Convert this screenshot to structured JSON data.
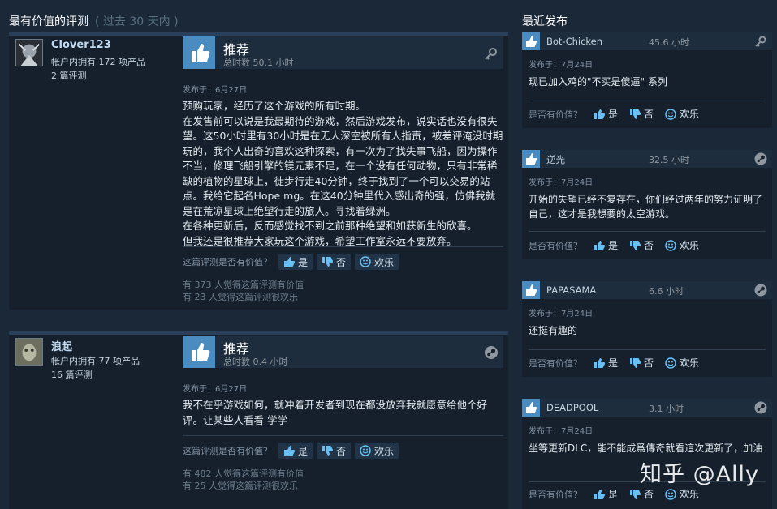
{
  "left_header": {
    "title": "最有价值的评测",
    "subtitle": "( 过去 30 天内 )"
  },
  "right_header": {
    "title": "最近发布"
  },
  "reviews": [
    {
      "username": "Clover123",
      "products": "帐户内拥有 172 项产品",
      "review_count": "2 篇评测",
      "recommend": "推荐",
      "hours": "总时数 50.1 小时",
      "posted": "发布于：6月27日",
      "text": "预购玩家，经历了这个游戏的所有时期。\n在发售前可以说是我最期待的游戏，然后游戏发布，说实话也没有很失望。这50小时里有30小时是在无人深空被所有人指责，被差评淹没时期玩的，我个人出奇的喜欢这种探索，有一次为了找失事飞船，因为操作不当，修理飞船引擎的镁元素不足，在一个没有任何动物，只有非常稀缺的植物的星球上，徒步行走40分钟，终于找到了一个可以交易的站点。我给它起名Hope mg。在这40分钟里代入感出奇的强，仿佛我就是在荒凉星球上绝望行走的旅人。寻找着绿洲。\n在各种更新后，反而感觉找不到之前那种绝望和如获新生的欣喜。\n但我还是很推荐大家玩这个游戏，希望工作室永远不要放弃。",
      "helpful_q": "这篇评测是否有价值？",
      "yes": "是",
      "no": "否",
      "funny": "欢乐",
      "count_helpful": "有 373 人觉得这篇评测有价值",
      "count_funny": "有 23 人觉得这篇评测很欢乐"
    },
    {
      "username": "浪起",
      "products": "帐户内拥有 77 项产品",
      "review_count": "16 篇评测",
      "recommend": "推荐",
      "hours": "总时数 0.4 小时",
      "posted": "发布于：6月27日",
      "text": "我不在乎游戏如何，就冲着开发者到现在都没放弃我就愿意给他个好评。让某些人看看 学学",
      "helpful_q": "这篇评测是否有价值？",
      "yes": "是",
      "no": "否",
      "funny": "欢乐",
      "count_helpful": "有 482 人觉得这篇评测有价值",
      "count_funny": "有 25 人觉得这篇评测很欢乐"
    }
  ],
  "recent": [
    {
      "name": "Bot-Chicken",
      "hours": "45.6 小时",
      "posted": "发布于：7月24日",
      "text": "现已加入鸡的\"不买是傻逼\" 系列",
      "helpful_q": "是否有价值？",
      "yes": "是",
      "no": "否",
      "funny": "欢乐",
      "icon": "key-icon"
    },
    {
      "name": "逆光",
      "hours": "32.5 小时",
      "posted": "发布于：7月24日",
      "text": "开始的失望已经不复存在，你们经过两年的努力证明了自己，这才是我想要的太空游戏。",
      "helpful_q": "是否有价值？",
      "yes": "是",
      "no": "否",
      "funny": "欢乐",
      "icon": "steam-icon"
    },
    {
      "name": "PAPASAMA",
      "hours": "6.6 小时",
      "posted": "发布于：7月24日",
      "text": "还挺有趣的",
      "helpful_q": "是否有价值？",
      "yes": "是",
      "no": "否",
      "funny": "欢乐",
      "icon": "steam-icon"
    },
    {
      "name": "DEADPOOL",
      "hours": "3.1 小时",
      "posted": "发布于：7月24日",
      "text": "坐等更新DLC，能不能成爲傳奇就看這次更新了，加油",
      "helpful_q": "是否有价值？",
      "yes": "是",
      "no": "否",
      "funny": "欢乐",
      "icon": "steam-icon"
    }
  ],
  "watermark": "知乎 @Ally",
  "colors": {
    "background": "#1b2838",
    "panel": "#16202d",
    "accent": "#4a8cbf",
    "username": "#c1dbf4"
  }
}
